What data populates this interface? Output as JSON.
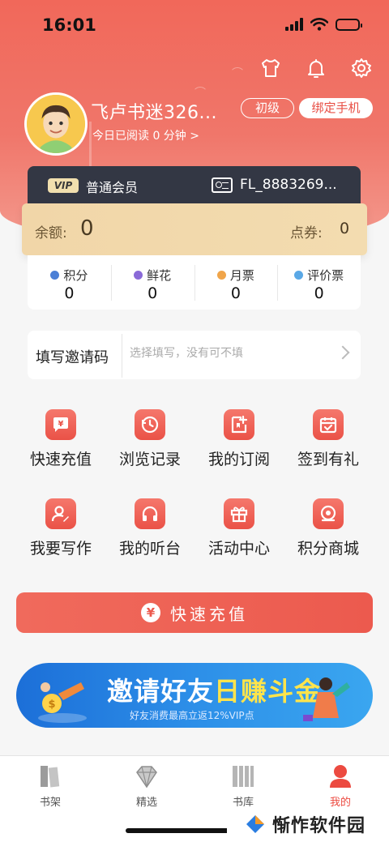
{
  "status_bar": {
    "time": "16:01",
    "battery_level": 0.3
  },
  "header": {
    "top_icons": [
      "shirt-icon",
      "bell-icon",
      "gear-icon"
    ],
    "username": "飞卢书迷326...",
    "read_today": "今日已阅读 0 分钟 >",
    "level": "初级",
    "bind_phone": "绑定手机"
  },
  "member": {
    "vip_tag": "VIP",
    "label": "普通会员",
    "id": "FL_8883269..."
  },
  "balance": {
    "balance_label": "余额:",
    "balance_value": "0",
    "coupon_label": "点券:",
    "coupon_value": "0"
  },
  "stats": [
    {
      "label": "积分",
      "value": "0",
      "color": "#4a7fd6"
    },
    {
      "label": "鲜花",
      "value": "0",
      "color": "#8a6ad8"
    },
    {
      "label": "月票",
      "value": "0",
      "color": "#f0a54a"
    },
    {
      "label": "评价票",
      "value": "0",
      "color": "#5aa8e6"
    }
  ],
  "invite": {
    "label": "填写邀请码",
    "placeholder": "选择填写，没有可不填"
  },
  "grid": [
    {
      "label": "快速充值",
      "icon": "yen-chat-icon"
    },
    {
      "label": "浏览记录",
      "icon": "history-icon"
    },
    {
      "label": "我的订阅",
      "icon": "subscribe-icon"
    },
    {
      "label": "签到有礼",
      "icon": "calendar-check-icon"
    },
    {
      "label": "我要写作",
      "icon": "writer-icon"
    },
    {
      "label": "我的听台",
      "icon": "headphones-icon"
    },
    {
      "label": "活动中心",
      "icon": "gift-icon"
    },
    {
      "label": "积分商城",
      "icon": "shop-icon"
    }
  ],
  "recharge_button": {
    "label": "快速充值",
    "icon_text": "¥"
  },
  "banner": {
    "title_part1": "邀请好友",
    "title_part2": "日赚斗金",
    "subtitle": "好友消费最高立返12%VIP点"
  },
  "tabs": [
    {
      "label": "书架",
      "icon": "bookshelf-icon",
      "active": false
    },
    {
      "label": "精选",
      "icon": "diamond-icon",
      "active": false
    },
    {
      "label": "书库",
      "icon": "library-icon",
      "active": false
    },
    {
      "label": "我的",
      "icon": "profile-icon",
      "active": true
    }
  ],
  "watermark": {
    "text": "惭怍软件园"
  },
  "colors": {
    "brand": "#ec5a4e",
    "member_card": "#333744",
    "balance_gold": "#f1d6a8"
  }
}
